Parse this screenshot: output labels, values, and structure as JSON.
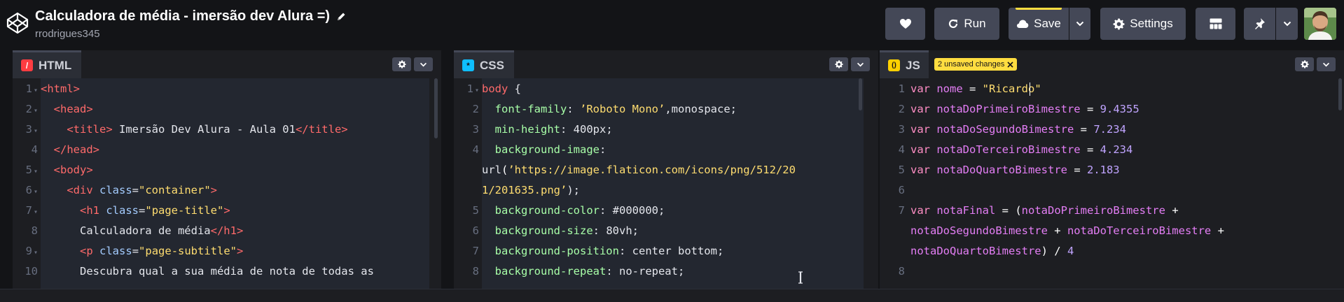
{
  "header": {
    "title": "Calculadora de média - imersão dev Alura =)",
    "author": "rrodrigues345",
    "run_label": "Run",
    "save_label": "Save",
    "settings_label": "Settings"
  },
  "panes": {
    "html": {
      "label": "HTML",
      "badge": "/"
    },
    "css": {
      "label": "CSS",
      "badge": "*"
    },
    "js": {
      "label": "JS",
      "badge": "()",
      "unsaved": "2 unsaved changes"
    }
  },
  "colors": {
    "accent_yellow": "#ffdd40",
    "html_badge": "#ff3c41",
    "css_badge": "#0ebeff",
    "js_badge": "#fcd000",
    "button_bg": "#444857",
    "editor_bg": "#1d1e22"
  },
  "html_code": [
    {
      "n": "1",
      "fold": true,
      "t": "<html>"
    },
    {
      "n": "2",
      "fold": true,
      "t": "  <head>"
    },
    {
      "n": "3",
      "fold": true,
      "t": "    <title> Imersão Dev Alura - Aula 01</title>"
    },
    {
      "n": "4",
      "fold": false,
      "t": "  </head>"
    },
    {
      "n": "5",
      "fold": true,
      "t": "  <body>"
    },
    {
      "n": "6",
      "fold": true,
      "t": "    <div class=\"container\">"
    },
    {
      "n": "7",
      "fold": true,
      "t": "      <h1 class=\"page-title\">"
    },
    {
      "n": "8",
      "fold": false,
      "t": "      Calculadora de média</h1>"
    },
    {
      "n": "9",
      "fold": true,
      "t": "      <p class=\"page-subtitle\">"
    },
    {
      "n": "10",
      "fold": false,
      "t": "      Descubra qual a sua média de nota de todas as"
    }
  ],
  "css_code": [
    {
      "n": "1",
      "fold": true,
      "t": "body {"
    },
    {
      "n": "2",
      "fold": false,
      "t": "  font-family: ’Roboto Mono’,monospace;"
    },
    {
      "n": "3",
      "fold": false,
      "t": "  min-height: 400px;"
    },
    {
      "n": "4",
      "fold": false,
      "t": "  background-image:"
    },
    {
      "n": "",
      "fold": false,
      "t": "url(’https://image.flaticon.com/icons/png/512/20"
    },
    {
      "n": "",
      "fold": false,
      "t": "1/201635.png’);"
    },
    {
      "n": "5",
      "fold": false,
      "t": "  background-color: #000000;"
    },
    {
      "n": "6",
      "fold": false,
      "t": "  background-size: 80vh;"
    },
    {
      "n": "7",
      "fold": false,
      "t": "  background-position: center bottom;"
    },
    {
      "n": "8",
      "fold": false,
      "t": "  background-repeat: no-repeat;"
    }
  ],
  "js_code": [
    {
      "n": "1",
      "t": "var nome = \"Ricardo\""
    },
    {
      "n": "2",
      "t": "var notaDoPrimeiroBimestre = 9.4355"
    },
    {
      "n": "3",
      "t": "var notaDoSegundoBimestre = 7.234"
    },
    {
      "n": "4",
      "t": "var notaDoTerceiroBimestre = 4.234"
    },
    {
      "n": "5",
      "t": "var notaDoQuartoBimestre = 2.183"
    },
    {
      "n": "6",
      "t": ""
    },
    {
      "n": "7",
      "t": "var notaFinal = (notaDoPrimeiroBimestre +"
    },
    {
      "n": "",
      "t": "notaDoSegundoBimestre + notaDoTerceiroBimestre +"
    },
    {
      "n": "",
      "t": "notaDoQuartoBimestre) / 4"
    },
    {
      "n": "8",
      "t": ""
    }
  ]
}
